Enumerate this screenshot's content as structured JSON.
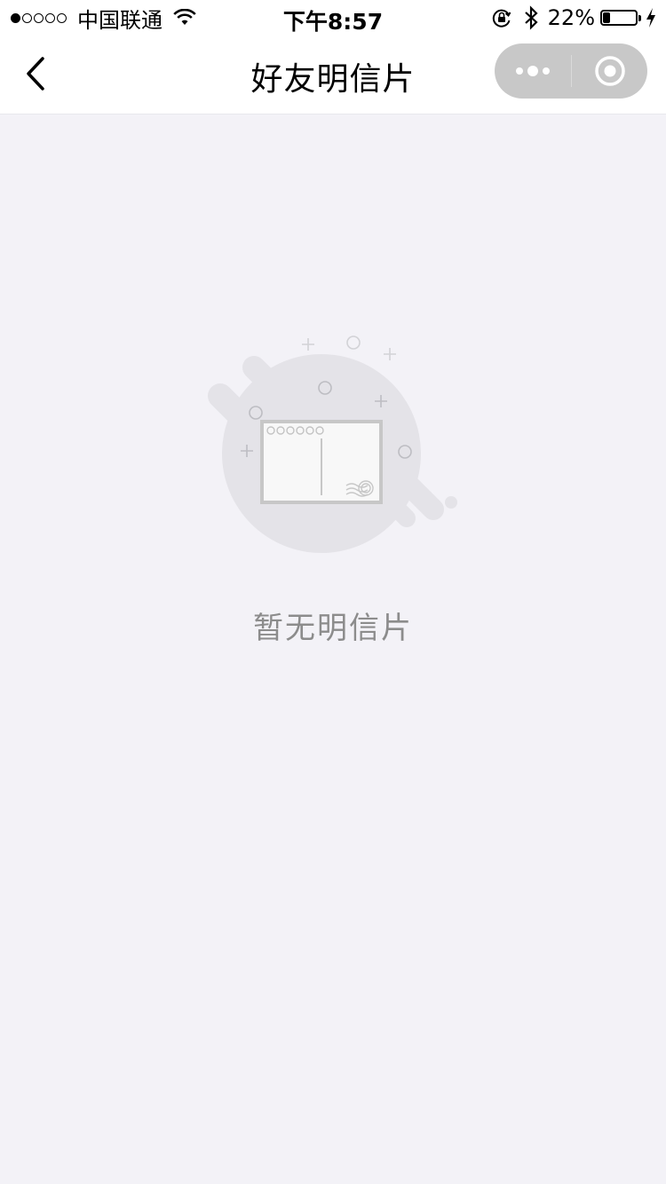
{
  "status_bar": {
    "carrier": "中国联通",
    "time": "下午8:57",
    "battery_percent": "22%",
    "battery_level": 0.22,
    "icons": [
      "signal-dots-icon",
      "wifi-icon",
      "orientation-lock-icon",
      "bluetooth-icon",
      "battery-icon",
      "charging-bolt-icon"
    ]
  },
  "nav": {
    "title": "好友明信片",
    "back_icon": "chevron-left-icon",
    "menu_icon": "more-dots-icon",
    "close_icon": "target-close-icon"
  },
  "empty_state": {
    "message": "暂无明信片",
    "illustration": "postcard-empty-icon"
  },
  "colors": {
    "background": "#f3f2f7",
    "nav_background": "#ffffff",
    "capsule": "#c8c8c8",
    "empty_text": "#8c8c8c",
    "illustration_blob": "#e4e3e8"
  }
}
